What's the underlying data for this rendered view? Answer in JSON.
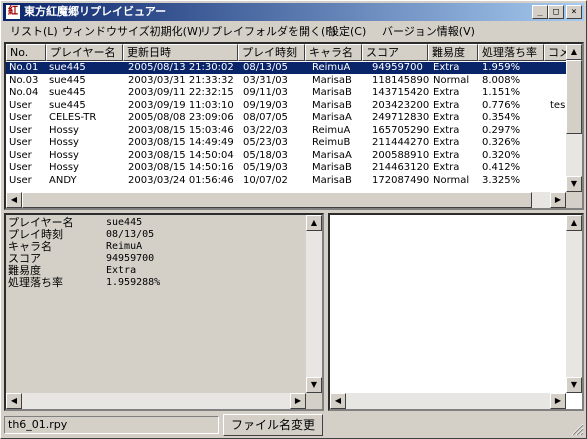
{
  "window": {
    "icon_char": "紅",
    "title": "東方紅魔郷リプレイビュアー",
    "buttons": {
      "minimize": "_",
      "maximize": "□",
      "close": "×"
    }
  },
  "menu": [
    {
      "label": "リスト(L)"
    },
    {
      "label": "ウィンドウサイズ初期化(W)"
    },
    {
      "label": "リプレイフォルダを開く(F)"
    },
    {
      "label": "設定(C)"
    },
    {
      "label": "バージョン情報(V)"
    }
  ],
  "list": {
    "columns": [
      "No.",
      "プレイヤー名",
      "更新日時",
      "プレイ時刻",
      "キャラ名",
      "スコア",
      "難易度",
      "処理落ち率",
      "コメ"
    ],
    "rows": [
      {
        "no": "No.01",
        "player": "sue445",
        "updated": "2005/08/13 21:30:02",
        "playdate": "08/13/05",
        "chara": "ReimuA",
        "score": "94959700",
        "level": "Extra",
        "slow": "1.959%",
        "comment": "",
        "selected": true
      },
      {
        "no": "No.03",
        "player": "sue445",
        "updated": "2003/03/31 21:33:32",
        "playdate": "03/31/03",
        "chara": "MarisaB",
        "score": "118145890",
        "level": "Normal",
        "slow": "8.008%",
        "comment": ""
      },
      {
        "no": "No.04",
        "player": "sue445",
        "updated": "2003/09/11 22:32:15",
        "playdate": "09/11/03",
        "chara": "MarisaB",
        "score": "143715420",
        "level": "Extra",
        "slow": "1.151%",
        "comment": ""
      },
      {
        "no": "User",
        "player": "sue445",
        "updated": "2003/09/19 11:03:10",
        "playdate": "09/19/03",
        "chara": "MarisaB",
        "score": "203423200",
        "level": "Extra",
        "slow": "0.776%",
        "comment": "tes"
      },
      {
        "no": "User",
        "player": "CELES-TR",
        "updated": "2005/08/08 23:09:06",
        "playdate": "08/07/05",
        "chara": "MarisaA",
        "score": "249712830",
        "level": "Extra",
        "slow": "0.354%",
        "comment": ""
      },
      {
        "no": "User",
        "player": "Hossy",
        "updated": "2003/08/15 15:03:46",
        "playdate": "03/22/03",
        "chara": "ReimuA",
        "score": "165705290",
        "level": "Extra",
        "slow": "0.297%",
        "comment": ""
      },
      {
        "no": "User",
        "player": "Hossy",
        "updated": "2003/08/15 14:49:49",
        "playdate": "05/23/03",
        "chara": "ReimuB",
        "score": "211444270",
        "level": "Extra",
        "slow": "0.326%",
        "comment": ""
      },
      {
        "no": "User",
        "player": "Hossy",
        "updated": "2003/08/15 14:50:04",
        "playdate": "05/18/03",
        "chara": "MarisaA",
        "score": "200588910",
        "level": "Extra",
        "slow": "0.320%",
        "comment": ""
      },
      {
        "no": "User",
        "player": "Hossy",
        "updated": "2003/08/15 14:50:16",
        "playdate": "05/19/03",
        "chara": "MarisaB",
        "score": "214463120",
        "level": "Extra",
        "slow": "0.412%",
        "comment": ""
      },
      {
        "no": "User",
        "player": "ANDY",
        "updated": "2003/03/24 01:56:46",
        "playdate": "10/07/02",
        "chara": "MarisaB",
        "score": "172087490",
        "level": "Normal",
        "slow": "3.325%",
        "comment": ""
      }
    ]
  },
  "detail": [
    {
      "label": "プレイヤー名",
      "value": "sue445"
    },
    {
      "label": "プレイ時刻",
      "value": "08/13/05"
    },
    {
      "label": "キャラ名",
      "value": "ReimuA"
    },
    {
      "label": "スコア",
      "value": "94959700"
    },
    {
      "label": "難易度",
      "value": "Extra"
    },
    {
      "label": "処理落ち率",
      "value": "1.959288%"
    }
  ],
  "status": {
    "filename": "th6_01.rpy",
    "rename_button": "ファイル名変更"
  },
  "scroll_glyphs": {
    "up": "▲",
    "down": "▼",
    "left": "◀",
    "right": "▶"
  },
  "colors": {
    "selection": "#0a246a",
    "title_start": "#0a246a",
    "title_end": "#a6caf0"
  }
}
